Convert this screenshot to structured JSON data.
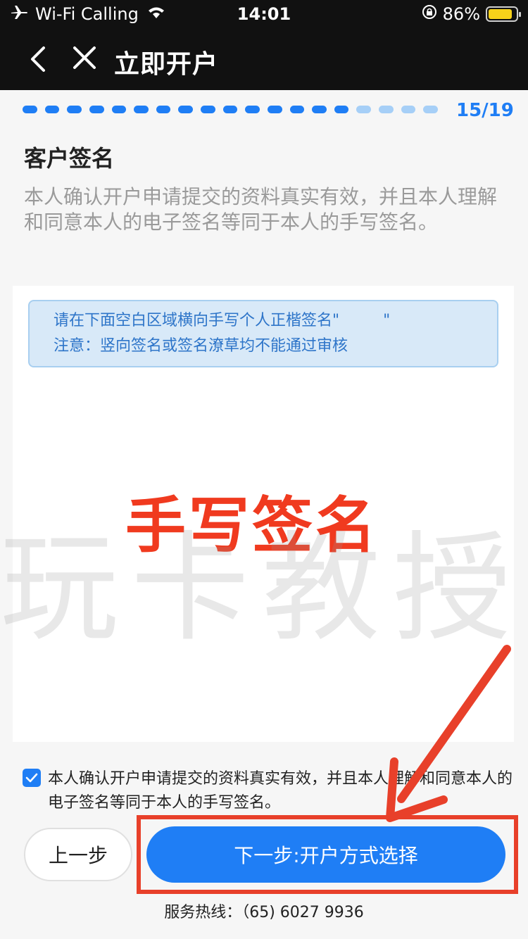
{
  "status_bar": {
    "carrier": "Wi-Fi Calling",
    "time": "14:01",
    "battery": "86%",
    "battery_color": "#f7d21a"
  },
  "nav": {
    "title": "立即开户",
    "back_icon": "chevron-left-icon",
    "close_icon": "close-icon"
  },
  "progress": {
    "current": 15,
    "total": 19,
    "label": "15/19",
    "active_color": "#1f7ef5",
    "inactive_color": "#a6cff7"
  },
  "page": {
    "heading": "客户签名",
    "description": "本人确认开户申请提交的资料真实有效，并且本人理解和同意本人的电子签名等同于本人的手写签名。"
  },
  "signature_pad": {
    "notice_line1_prefix": "请在下面空白区域横向手写个人正楷签名\"",
    "notice_line1_suffix": "\"",
    "notice_line2": "注意：竖向签名或签名潦草均不能通过审核",
    "overlay_label": "手写签名",
    "watermark": "玩卡教授"
  },
  "agreement": {
    "checked": true,
    "text": "本人确认开户申请提交的资料真实有效，并且本人理解和同意本人的电子签名等同于本人的手写签名。"
  },
  "buttons": {
    "prev": "上一步",
    "next": "下一步:开户方式选择"
  },
  "footer": {
    "hotline": "服务热线：（65) 6027 9936"
  }
}
